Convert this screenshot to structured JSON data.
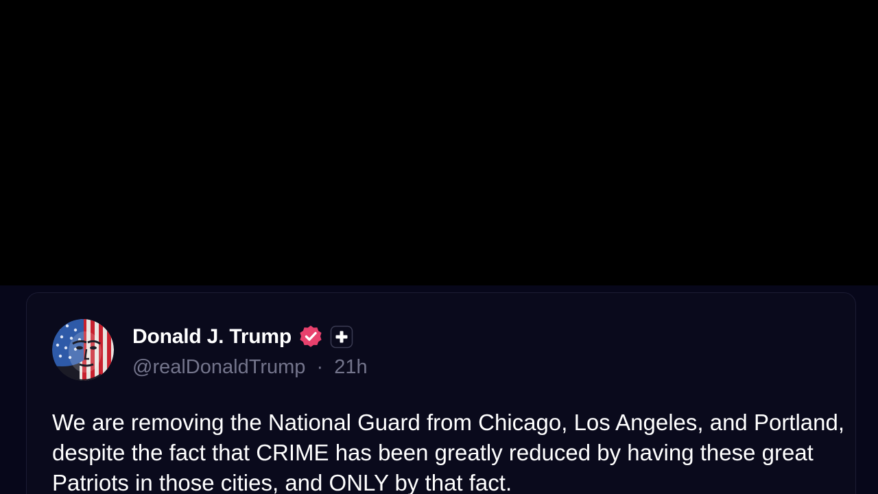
{
  "post": {
    "author_name": "Donald J. Trump",
    "handle": "@realDonaldTrump",
    "separator": "·",
    "time_ago": "21h",
    "text": "We are removing the National Guard from Chicago, Los Angeles, and Portland, despite the fact that CRIME has been greatly reduced by having these great Patriots in those cities, and ONLY by that fact."
  },
  "icons": {
    "avatar": "american-flag-portrait-avatar",
    "verified": "verified-badge-icon",
    "plus": "plus-icon"
  },
  "colors": {
    "background": "#07071a",
    "card_background": "#0a0a1c",
    "card_border": "#1c1c34",
    "name_text": "#ffffff",
    "meta_text": "#74758c",
    "verified_badge": "#e8416d"
  }
}
